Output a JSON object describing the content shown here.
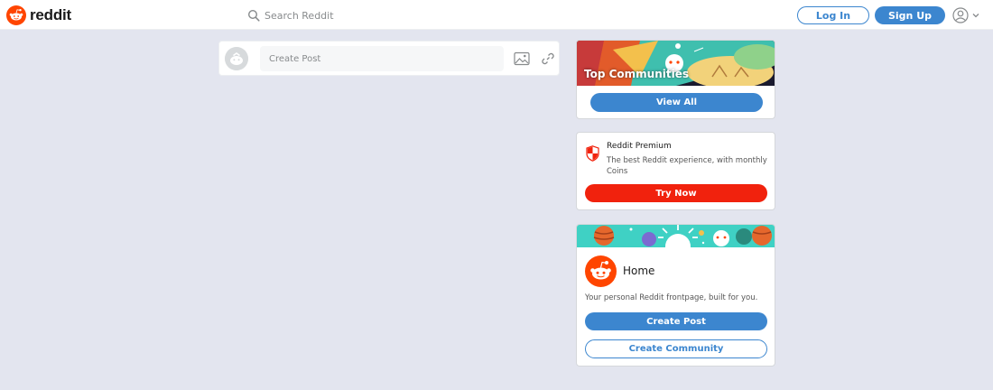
{
  "brand": {
    "name": "reddit",
    "logo_icon": "reddit-snoo-icon",
    "colors": {
      "orange": "#ff4500",
      "blue": "#3c86cf",
      "premium_red": "#f1220d",
      "background": "#e3e5ef"
    }
  },
  "header": {
    "search": {
      "placeholder": "Search Reddit",
      "icon": "search-icon"
    },
    "login_label": "Log In",
    "signup_label": "Sign Up",
    "user_menu": {
      "icon": "user-icon",
      "chevron": "chevron-down-icon"
    }
  },
  "create_post_bar": {
    "placeholder": "Create Post",
    "icons": [
      "image-icon",
      "link-icon"
    ]
  },
  "sidebar": {
    "top_communities": {
      "title": "Top Communities",
      "button_label": "View All"
    },
    "premium": {
      "icon": "shield-icon",
      "title": "Reddit Premium",
      "description": "The best Reddit experience, with monthly Coins",
      "button_label": "Try Now"
    },
    "home": {
      "title": "Home",
      "description": "Your personal Reddit frontpage, built for you.",
      "create_post_label": "Create Post",
      "create_community_label": "Create Community"
    }
  }
}
